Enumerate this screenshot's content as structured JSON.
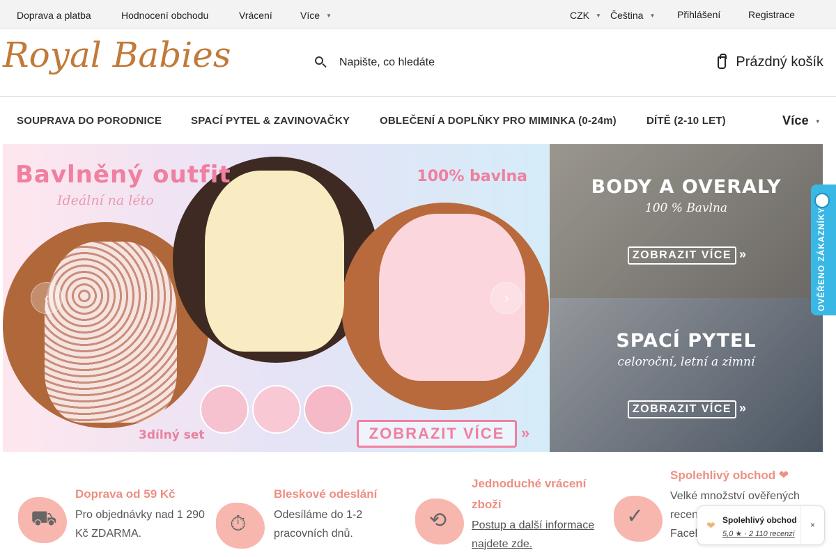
{
  "topbar": {
    "links": [
      "Doprava a platba",
      "Hodnocení obchodu",
      "Vrácení",
      "Více"
    ],
    "currency": "CZK",
    "language": "Čeština",
    "login": "Přihlášení",
    "register": "Registrace"
  },
  "header": {
    "logo": "Royal Babies",
    "search_placeholder": "Napište, co hledáte",
    "cart_label": "Prázdný košík"
  },
  "nav": {
    "items": [
      "SOUPRAVA DO PORODNICE",
      "SPACÍ PYTEL & ZAVINOVAČKY",
      "OBLEČENÍ A DOPLŇKY PRO MIMINKA (0-24m)",
      "DÍTĚ (2-10 LET)"
    ],
    "more": "Více"
  },
  "hero": {
    "title": "Bavlněný outfit",
    "subtitle": "Ideální na léto",
    "cotton": "100% bavlna",
    "set_label": "3dílný set",
    "button": "ZOBRAZIT VÍCE",
    "colors": {
      "accent": "#f07fa0",
      "background_left": "#ffe6ee",
      "background_right": "#d5ecf8"
    }
  },
  "side_banners": [
    {
      "title": "BODY A OVERALY",
      "subtitle": "100 % Bavlna",
      "button": "ZOBRAZIT VÍCE"
    },
    {
      "title": "SPACÍ PYTEL",
      "subtitle": "celoroční, letní a zimní",
      "button": "ZOBRAZIT VÍCE"
    }
  ],
  "verified_tab": {
    "label": "OVĚŘENO ZÁKAZNÍKY"
  },
  "features": [
    {
      "icon": "truck-icon",
      "title": "Doprava od 59 Kč",
      "text": "Pro objednávky nad 1 290 Kč ZDARMA."
    },
    {
      "icon": "stopwatch-icon",
      "title": "Bleskové odeslání",
      "text": "Odesíláme do 1-2 pracovních dnů."
    },
    {
      "icon": "return-box-icon",
      "title": "Jednoduché vrácení zboží",
      "text": "Postup a další informace najdete zde."
    },
    {
      "icon": "check-circle-icon",
      "title": "Spolehlivý obchod ❤",
      "text": "Velké množství ověřených recenzí na Google, Facebooku, Heurece."
    }
  ],
  "trust_badge": {
    "name": "Spolehlivý obchod",
    "rating": "5,0 ★ · 2 110 recenzí",
    "close": "×"
  }
}
